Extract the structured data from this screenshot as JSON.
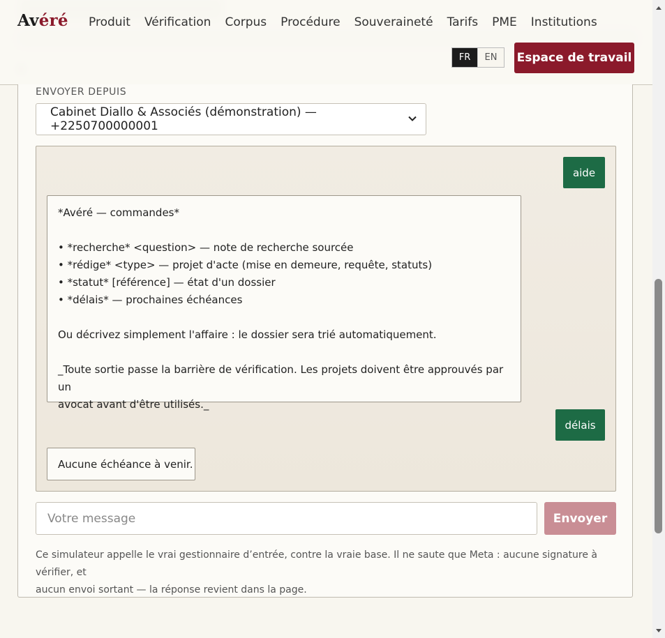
{
  "brand": {
    "name_start": "Av",
    "name_accent": "éré"
  },
  "nav": [
    "Produit",
    "Vérification",
    "Corpus",
    "Procédure",
    "Souveraineté",
    "Tarifs",
    "PME",
    "Institutions"
  ],
  "lang": {
    "fr": "FR",
    "en": "EN",
    "active": "FR"
  },
  "workspace_label": "Espace de travail",
  "sender": {
    "label": "ENVOYER DEPUIS",
    "selected": "Cabinet Diallo & Associés (démonstration) — +2250700000001"
  },
  "chat": {
    "cmd_help": "aide",
    "help_reply": {
      "title": "*Avéré — commandes*",
      "items": [
        "• *recherche* <question> — note de recherche sourcée",
        "• *rédige* <type> — projet d'acte (mise en demeure, requête, statuts)",
        "• *statut* [référence] — état d'un dossier",
        "• *délais* — prochaines échéances"
      ],
      "hint": "Ou décrivez simplement l'affaire : le dossier sera trié automatiquement.",
      "note_line1": "_Toute sortie passe la barrière de vérification. Les projets doivent être approuvés par un",
      "note_line2": "avocat avant d'être utilisés._"
    },
    "cmd_deadlines": "délais",
    "deadlines_reply": "Aucune échéance à venir."
  },
  "composer": {
    "placeholder": "Votre message",
    "send_label": "Envoyer"
  },
  "footnote_line1": "Ce simulateur appelle le vrai gestionnaire d’entrée, contre la vraie base. Il ne saute que Meta : aucune signature à vérifier, et",
  "footnote_line2": "aucun envoi sortant — la réponse revient dans la page.",
  "colors": {
    "brand": "#8b1a2b",
    "green": "#1d6b45",
    "send_disabled": "#c98e95"
  }
}
